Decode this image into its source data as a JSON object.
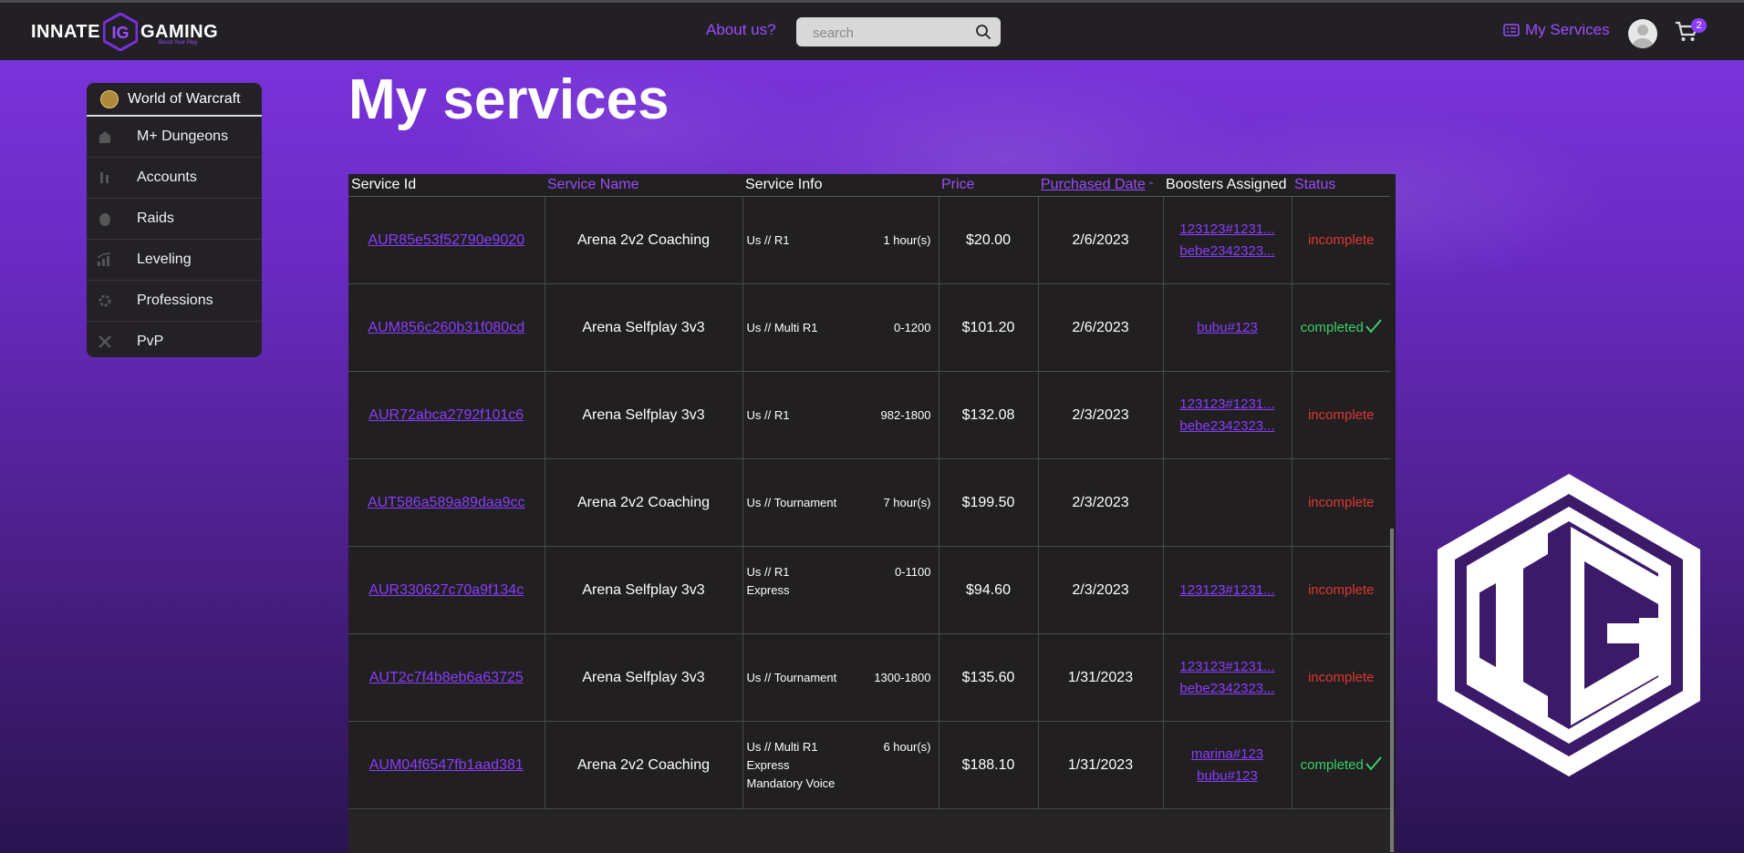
{
  "header": {
    "logo_left": "INNATE",
    "logo_right": "GAMING",
    "logo_tagline": "Boost Your Play",
    "about_label": "About us?",
    "search_placeholder": "search",
    "my_services_label": "My Services",
    "cart_count": "2"
  },
  "sidebar": {
    "game_title": "World of Warcraft",
    "items": [
      {
        "label": "M+ Dungeons",
        "icon": "dungeon-icon"
      },
      {
        "label": "Accounts",
        "icon": "accounts-icon"
      },
      {
        "label": "Raids",
        "icon": "raids-icon"
      },
      {
        "label": "Leveling",
        "icon": "leveling-icon"
      },
      {
        "label": "Professions",
        "icon": "professions-icon"
      },
      {
        "label": "PvP",
        "icon": "pvp-icon"
      }
    ]
  },
  "main": {
    "title": "My services",
    "columns": [
      "Service Id",
      "Service Name",
      "Service Info",
      "Price",
      "Purchased Date",
      "Boosters Assigned",
      "Status"
    ],
    "rows": [
      {
        "id": "AUR85e53f52790e9020",
        "name": "Arena 2v2 Coaching",
        "info_left": [
          "Us // R1"
        ],
        "info_right": "1 hour(s)",
        "price": "$20.00",
        "date": "2/6/2023",
        "boosters": [
          "123123#1231...",
          "bebe2342323..."
        ],
        "status": "incomplete"
      },
      {
        "id": "AUM856c260b31f080cd",
        "name": "Arena Selfplay 3v3",
        "info_left": [
          "Us // Multi R1"
        ],
        "info_right": "0-1200",
        "price": "$101.20",
        "date": "2/6/2023",
        "boosters": [
          "bubu#123"
        ],
        "status": "completed"
      },
      {
        "id": "AUR72abca2792f101c6",
        "name": "Arena Selfplay 3v3",
        "info_left": [
          "Us // R1"
        ],
        "info_right": "982-1800",
        "price": "$132.08",
        "date": "2/3/2023",
        "boosters": [
          "123123#1231...",
          "bebe2342323..."
        ],
        "status": "incomplete"
      },
      {
        "id": "AUT586a589a89daa9cc",
        "name": "Arena 2v2 Coaching",
        "info_left": [
          "Us // Tournament"
        ],
        "info_right": "7 hour(s)",
        "price": "$199.50",
        "date": "2/3/2023",
        "boosters": [],
        "status": "incomplete"
      },
      {
        "id": "AUR330627c70a9f134c",
        "name": "Arena Selfplay 3v3",
        "info_left": [
          "Us // R1",
          "Express"
        ],
        "info_right": "0-1100",
        "price": "$94.60",
        "date": "2/3/2023",
        "boosters": [
          "123123#1231..."
        ],
        "status": "incomplete"
      },
      {
        "id": "AUT2c7f4b8eb6a63725",
        "name": "Arena Selfplay 3v3",
        "info_left": [
          "Us // Tournament"
        ],
        "info_right": "1300-1800",
        "price": "$135.60",
        "date": "1/31/2023",
        "boosters": [
          "123123#1231...",
          "bebe2342323..."
        ],
        "status": "incomplete"
      },
      {
        "id": "AUM04f6547fb1aad381",
        "name": "Arena 2v2 Coaching",
        "info_left": [
          "Us // Multi R1",
          "Express",
          "Mandatory Voice"
        ],
        "info_right": "6 hour(s)",
        "price": "$188.10",
        "date": "1/31/2023",
        "boosters": [
          "marina#123",
          "bubu#123"
        ],
        "status": "completed"
      }
    ]
  },
  "colors": {
    "accent": "#8a3dff",
    "incomplete": "#e03535",
    "completed": "#3bd06a",
    "header_bg": "#232025"
  }
}
